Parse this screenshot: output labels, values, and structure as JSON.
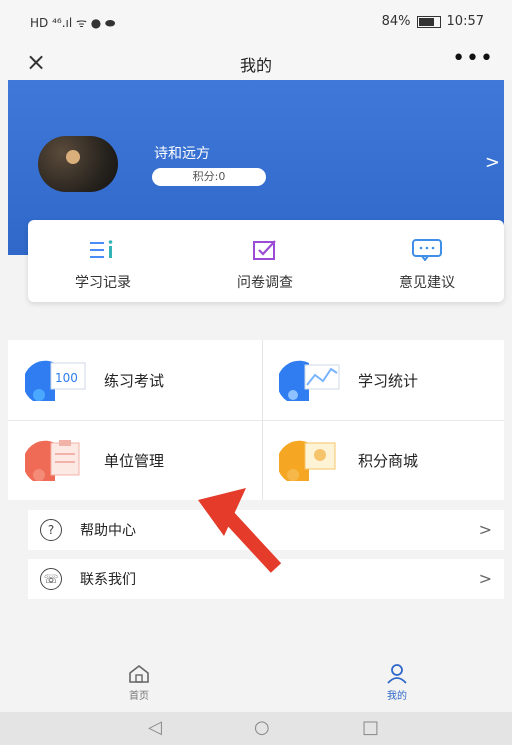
{
  "status": {
    "left_icons": "HD ⁴⁶.ıl ᯤ ● ⬬",
    "battery": "84%",
    "time": "10:57"
  },
  "nav": {
    "title": "我的",
    "close": "×",
    "more": "•••"
  },
  "profile": {
    "name": "诗和远方",
    "points": "积分:0"
  },
  "quick": [
    {
      "label": "学习记录"
    },
    {
      "label": "问卷调查"
    },
    {
      "label": "意见建议"
    }
  ],
  "grid": [
    {
      "label": "练习考试"
    },
    {
      "label": "学习统计"
    },
    {
      "label": "单位管理"
    },
    {
      "label": "积分商城"
    }
  ],
  "list": [
    {
      "label": "帮助中心",
      "icon": "?"
    },
    {
      "label": "联系我们",
      "icon": "☏"
    }
  ],
  "tabs": [
    {
      "label": "首页"
    },
    {
      "label": "我的"
    }
  ],
  "colors": {
    "primary": "#2f68c9",
    "accent_red": "#e53b2a"
  }
}
